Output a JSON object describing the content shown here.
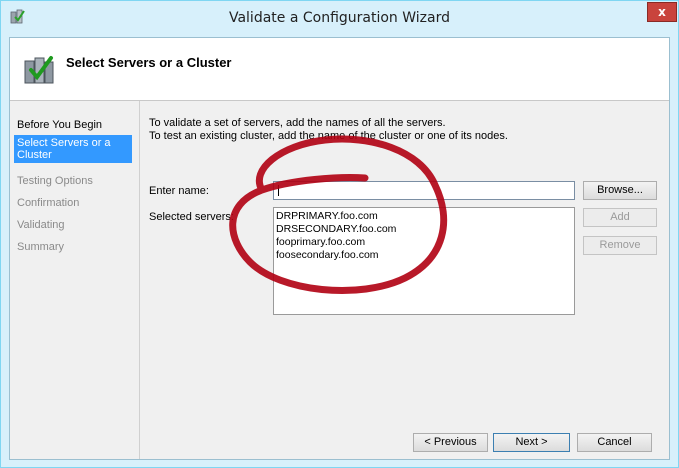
{
  "window": {
    "title": "Validate a Configuration Wizard",
    "close_glyph": "x"
  },
  "header": {
    "title": "Select Servers or a Cluster"
  },
  "steps": [
    {
      "label": "Before You Begin",
      "state": "done"
    },
    {
      "label": "Select Servers or a Cluster",
      "state": "active"
    },
    {
      "label": "Testing Options",
      "state": "pending"
    },
    {
      "label": "Confirmation",
      "state": "pending"
    },
    {
      "label": "Validating",
      "state": "pending"
    },
    {
      "label": "Summary",
      "state": "pending"
    }
  ],
  "content": {
    "line1": "To validate a set of servers, add the names of all the servers.",
    "line2": "To test an existing cluster, add the name of the cluster or one of its nodes.",
    "enter_name_label": "Enter name:",
    "enter_name_value": "",
    "selected_servers_label": "Selected servers:",
    "servers": [
      "DRPRIMARY.foo.com",
      "DRSECONDARY.foo.com",
      "fooprimary.foo.com",
      "foosecondary.foo.com"
    ],
    "browse_label": "Browse...",
    "add_label": "Add",
    "remove_label": "Remove"
  },
  "footer": {
    "previous_label": "< Previous",
    "next_label": "Next >",
    "cancel_label": "Cancel"
  },
  "colors": {
    "accent": "#3399ff",
    "annotation": "#b00012"
  }
}
